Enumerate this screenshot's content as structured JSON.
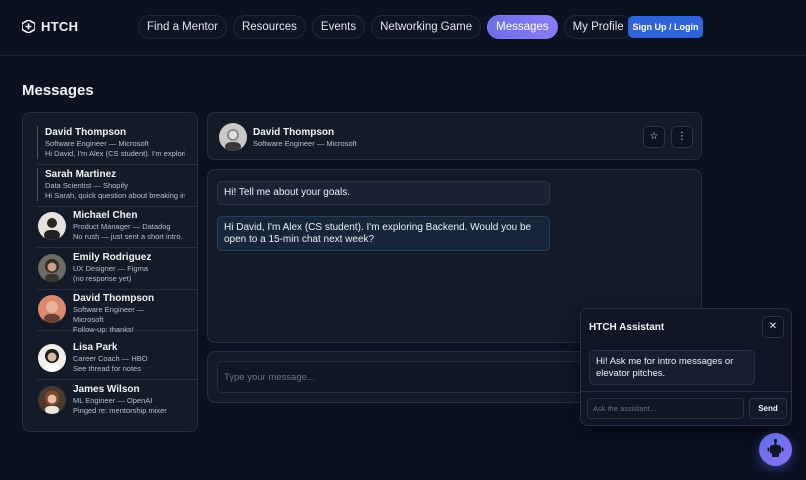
{
  "brand": {
    "name": "HTCH",
    "accent": "#7c7ff0",
    "button": "#2f63d8"
  },
  "nav": {
    "links": [
      "Find a Mentor",
      "Resources",
      "Events",
      "Networking Game",
      "Messages",
      "My Profile"
    ],
    "active": "Messages",
    "signup": "Sign Up / Login"
  },
  "page": {
    "title": "Messages"
  },
  "conversations": [
    {
      "name": "David Thompson",
      "role": "Software Engineer — Microsoft",
      "snippet": "Hi David, I'm Alex (CS student). I'm exploring",
      "avatar": false
    },
    {
      "name": "Sarah Martinez",
      "role": "Data Scientist — Shopify",
      "snippet": "Hi Sarah, quick question about breaking int",
      "avatar": false
    },
    {
      "name": "Michael Chen",
      "role": "Product Manager — Datadog",
      "snippet": "No rush — just sent a short intro.",
      "avatar": true
    },
    {
      "name": "Emily Rodriguez",
      "role": "UX Designer — Figma",
      "snippet": "(no response yet)",
      "avatar": true
    },
    {
      "name": "David Thompson",
      "role": "Software Engineer — Microsoft",
      "snippet": "Follow-up: thanks!",
      "avatar": true
    },
    {
      "name": "Lisa Park",
      "role": "Career Coach — HBO",
      "snippet": "See thread for notes",
      "avatar": true
    },
    {
      "name": "James Wilson",
      "role": "ML Engineer — OpenAI",
      "snippet": "Pinged re: mentorship mixer",
      "avatar": true
    }
  ],
  "chat": {
    "name": "David Thompson",
    "role": "Software Engineer — Microsoft",
    "star_icon": "star-icon",
    "more_icon": "more-vertical-icon",
    "messages": [
      {
        "text": "Hi! Tell me about your goals."
      },
      {
        "text": "Hi David, I'm Alex (CS student). I'm exploring Backend. Would you be open to a 15-min chat next week?"
      }
    ],
    "input_placeholder": "Type your message..."
  },
  "assistant": {
    "title": "HTCH Assistant",
    "close": "✕",
    "message": "Hi! Ask me for intro messages or elevator pitches.",
    "input_placeholder": "Ask the assistant...",
    "send": "Send"
  },
  "fab_icon": "assistant-bot-icon"
}
